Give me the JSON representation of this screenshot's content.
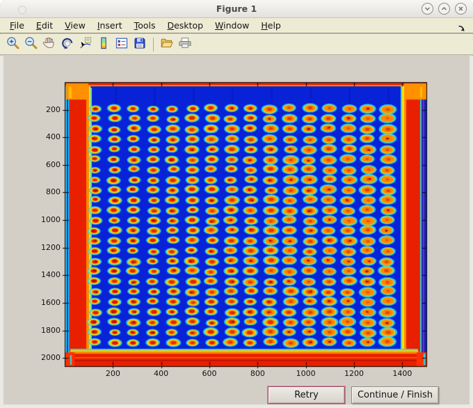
{
  "window": {
    "title": "Figure 1"
  },
  "menubar": {
    "items": [
      "File",
      "Edit",
      "View",
      "Insert",
      "Tools",
      "Desktop",
      "Window",
      "Help"
    ]
  },
  "toolbar": {
    "items": [
      {
        "icon": "zoom-in"
      },
      {
        "icon": "zoom-out"
      },
      {
        "icon": "pan"
      },
      {
        "icon": "rotate-3d"
      },
      {
        "icon": "data-cursor"
      },
      {
        "icon": "colorbar"
      },
      {
        "icon": "legend"
      },
      {
        "icon": "save"
      },
      {
        "icon": "separator"
      },
      {
        "icon": "open"
      },
      {
        "icon": "print"
      }
    ]
  },
  "chart_data": {
    "type": "heatmap",
    "title": "",
    "description": "Pseudocolor (jet colormap) scan of a microtiter plate: dark-blue field, red-hot plate edges, and a grid of 16 columns x 24 rows of assay spots with red/orange cores, yellow rings and cyan halos; right-hand columns trend more yellow-orange",
    "x_ticks": [
      200,
      400,
      600,
      800,
      1000,
      1200,
      1400
    ],
    "y_ticks": [
      200,
      400,
      600,
      800,
      1000,
      1200,
      1400,
      1600,
      1800,
      2000
    ],
    "x_range": [
      0,
      1500
    ],
    "y_range": [
      0,
      2060
    ],
    "grid": {
      "cols": 16,
      "rows": 24
    },
    "colormap": "jet",
    "colors": {
      "field": "#0822d8",
      "edge_hot": "#e82000",
      "edge_warm": "#ff8800",
      "ring": "#ffd400",
      "halo": "#2ed8ee",
      "core": "#d81400"
    }
  },
  "action_bar": {
    "retry": "Retry",
    "continue": "Continue / Finish"
  }
}
